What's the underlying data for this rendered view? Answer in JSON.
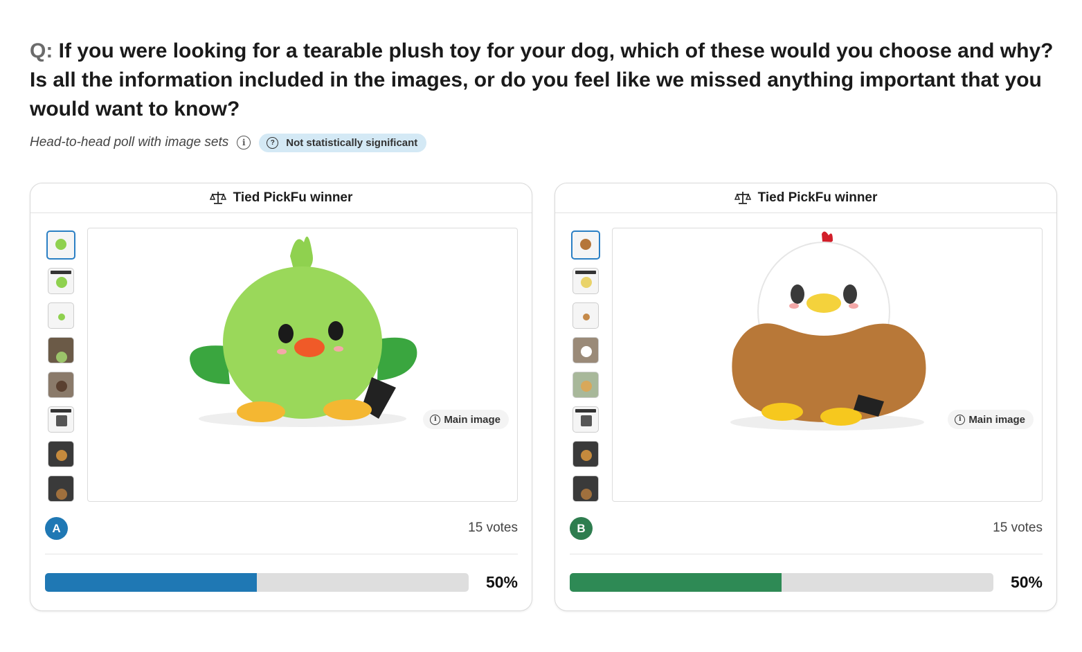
{
  "question": {
    "prefix": "Q:",
    "text": "If you were looking for a tearable plush toy for your dog, which of these would you choose and why? Is all the information included in the images, or do you feel like we missed anything important that you would want to know?"
  },
  "meta": {
    "poll_type": "Head-to-head poll with image sets",
    "significance_badge": "Not statistically significant"
  },
  "colors": {
    "option_a": "#1f78b4",
    "option_b": "#2e8a55",
    "badge_bg": "#d4e9f5"
  },
  "options": [
    {
      "letter": "A",
      "header": "Tied PickFu winner",
      "header_icon": "scale-icon",
      "main_image_label": "Main image",
      "votes": "15 votes",
      "percent": "50%",
      "share": 0.5,
      "thumbnail_count": 8
    },
    {
      "letter": "B",
      "header": "Tied PickFu winner",
      "header_icon": "scale-icon",
      "main_image_label": "Main image",
      "votes": "15 votes",
      "percent": "50%",
      "share": 0.5,
      "thumbnail_count": 8
    }
  ]
}
